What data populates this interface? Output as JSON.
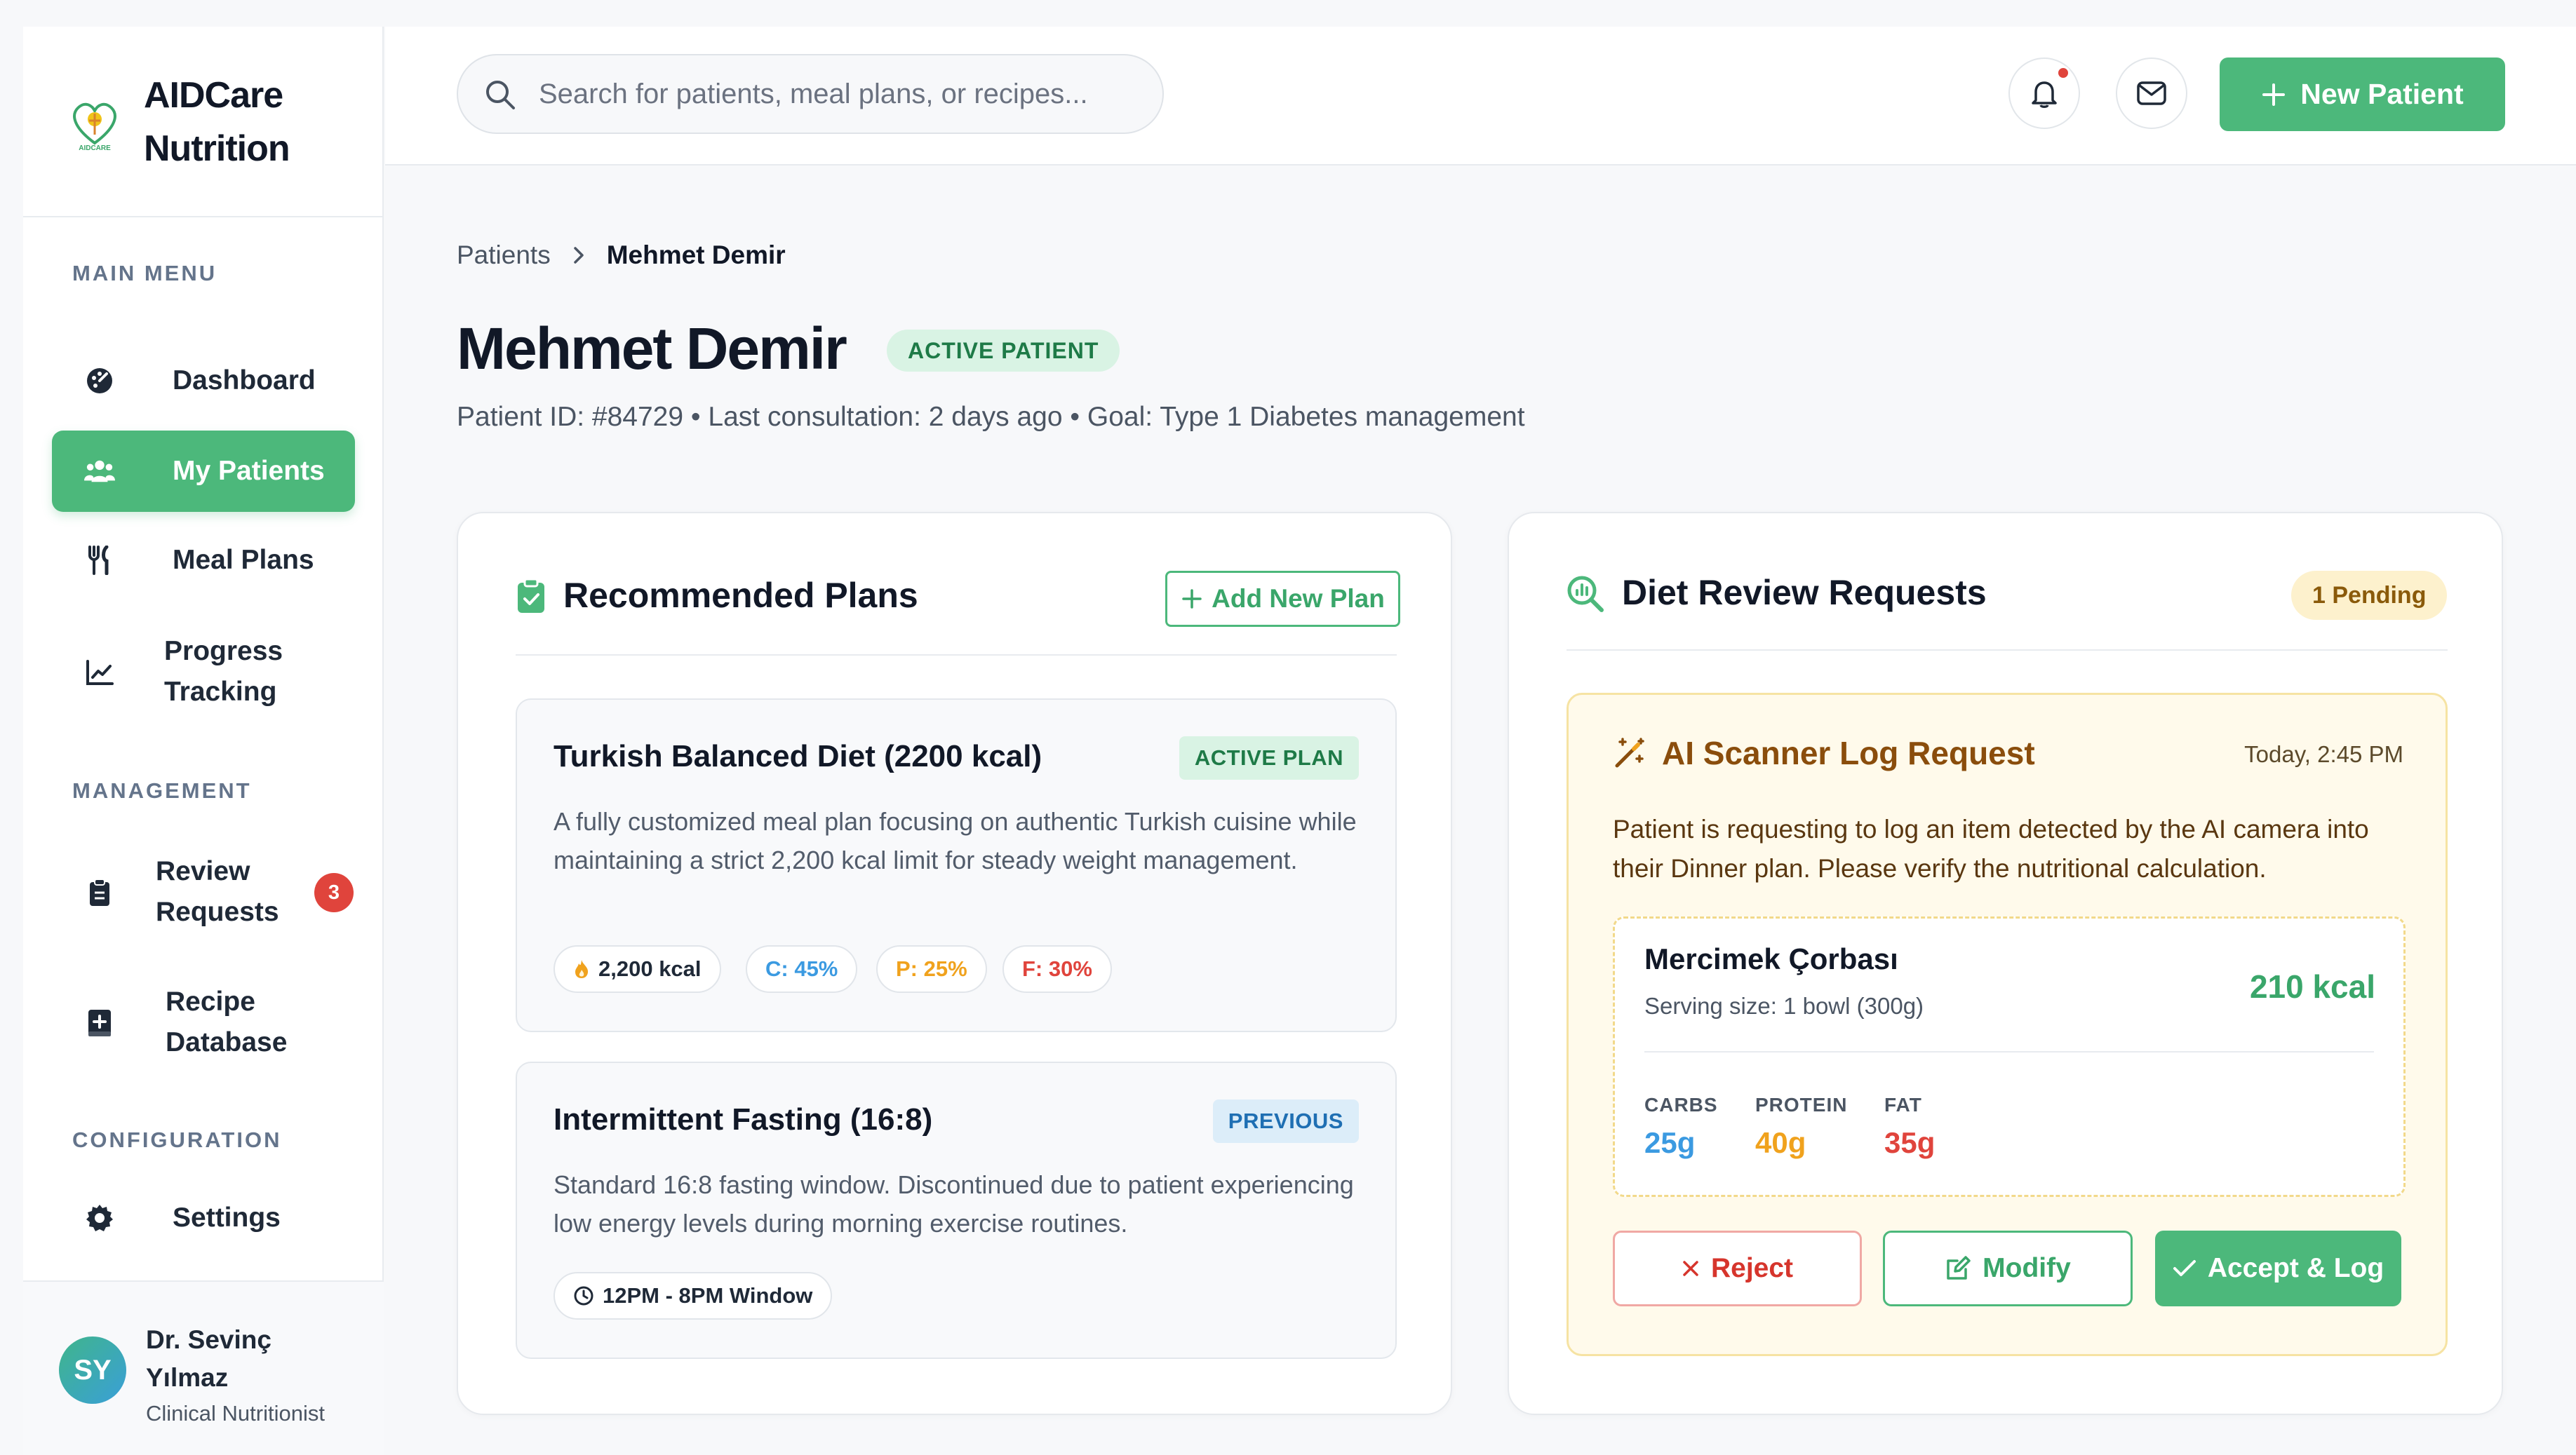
{
  "brand": {
    "name_line1": "AIDCare",
    "name_line2": "Nutrition",
    "logo_text": "AIDCARE"
  },
  "sidebar": {
    "sections": {
      "main": "MAIN MENU",
      "management": "MANAGEMENT",
      "configuration": "CONFIGURATION"
    },
    "items": {
      "dashboard": {
        "label": "Dashboard",
        "icon": "dashboard-icon"
      },
      "patients": {
        "label": "My Patients",
        "icon": "users-icon",
        "active": true
      },
      "meal_plans": {
        "label": "Meal Plans",
        "icon": "utensils-icon"
      },
      "progress_l1": "Progress",
      "progress_l2": "Tracking",
      "review_l1": "Review",
      "review_l2": "Requests",
      "review_badge": "3",
      "recipe_l1": "Recipe",
      "recipe_l2": "Database",
      "settings": {
        "label": "Settings",
        "icon": "gear-icon"
      }
    },
    "user": {
      "initials": "SY",
      "name_l1": "Dr. Sevinç",
      "name_l2": "Yılmaz",
      "role": "Clinical Nutritionist"
    }
  },
  "topbar": {
    "search_placeholder": "Search for patients, meal plans, or recipes...",
    "new_patient": "New Patient"
  },
  "breadcrumb": {
    "parent": "Patients",
    "current": "Mehmet Demir"
  },
  "patient": {
    "name": "Mehmet Demir",
    "status": "ACTIVE PATIENT",
    "meta": "Patient ID: #84729 • Last consultation: 2 days ago • Goal: Type 1 Diabetes management"
  },
  "plans_card": {
    "title": "Recommended Plans",
    "add_label": "Add New Plan",
    "plans": [
      {
        "name": "Turkish Balanced Diet (2200 kcal)",
        "tag": "ACTIVE PLAN",
        "desc": "A fully customized meal plan focusing on authentic Turkish cuisine while maintaining a strict 2,200 kcal limit for steady weight management.",
        "chips": [
          "2,200 kcal",
          "C: 45%",
          "P: 25%",
          "F: 30%"
        ]
      },
      {
        "name": "Intermittent Fasting (16:8)",
        "tag": "PREVIOUS",
        "desc": "Standard 16:8 fasting window. Discontinued due to patient experiencing low energy levels during morning exercise routines.",
        "chips": [
          "12PM - 8PM Window"
        ]
      }
    ]
  },
  "review_card": {
    "title": "Diet Review Requests",
    "pending": "1 Pending",
    "request": {
      "title": "AI Scanner Log Request",
      "time": "Today, 2:45 PM",
      "desc": "Patient is requesting to log an item detected by the AI camera into their Dinner plan. Please verify the nutritional calculation.",
      "food": {
        "name": "Mercimek Çorbası",
        "serving": "Serving size: 1 bowl (300g)",
        "kcal": "210 kcal",
        "macros": [
          {
            "label": "CARBS",
            "value": "25g"
          },
          {
            "label": "PROTEIN",
            "value": "40g"
          },
          {
            "label": "FAT",
            "value": "35g"
          }
        ]
      },
      "actions": {
        "reject": "Reject",
        "modify": "Modify",
        "accept": "Accept & Log"
      }
    }
  },
  "colors": {
    "accent": "#4cb87b",
    "danger": "#e0443c",
    "carbs": "#3b9ae1",
    "protein": "#f0a21d",
    "fat": "#e0443c",
    "warning_bg": "#fffaeb",
    "warning_border": "#f6e3a3"
  }
}
